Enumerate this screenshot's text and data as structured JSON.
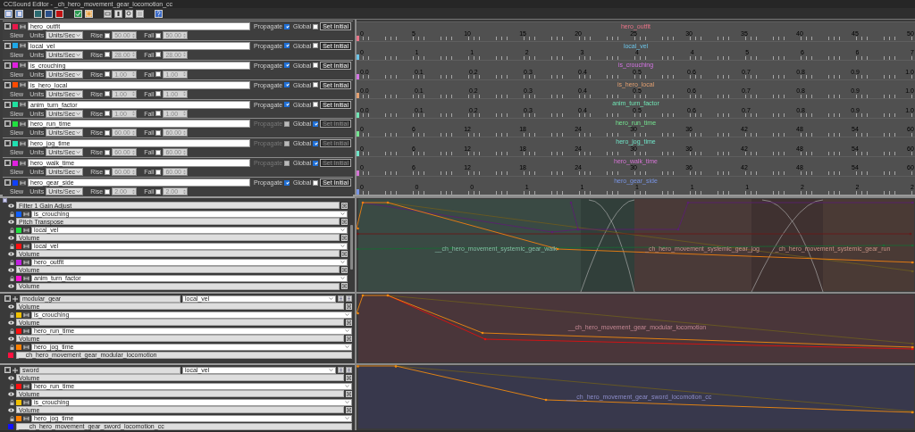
{
  "window": {
    "title": "CCSound Editor - _ch_hero_movement_gear_locomotion_cc"
  },
  "parameters": [
    {
      "name": "hero_outfit",
      "color": "#e8174a",
      "propagate_label": "Propagate",
      "propagate": true,
      "propagate_disabled": false,
      "global_label": "Global",
      "global": false,
      "set_initial": "Set Initial",
      "set_initial_disabled": false,
      "slew_label": "Slew",
      "units_label": "Units",
      "units": "Units/Sec",
      "rise_label": "Rise",
      "rise_checked": false,
      "rise": "50.00",
      "fall_label": "Fall",
      "fall_checked": false,
      "fall": "50.00"
    },
    {
      "name": "local_vel",
      "color": "#1ea8e8",
      "propagate_label": "Propagate",
      "propagate": true,
      "propagate_disabled": false,
      "global_label": "Global",
      "global": false,
      "set_initial": "Set Initial",
      "set_initial_disabled": false,
      "slew_label": "Slew",
      "units_label": "Units",
      "units": "Units/Sec",
      "rise_label": "Rise",
      "rise_checked": false,
      "rise": "28.00",
      "fall_label": "Fall",
      "fall_checked": false,
      "fall": "28.00"
    },
    {
      "name": "is_crouching",
      "color": "#e020e0",
      "propagate_label": "Propagate",
      "propagate": true,
      "propagate_disabled": false,
      "global_label": "Global",
      "global": false,
      "set_initial": "Set Initial",
      "set_initial_disabled": false,
      "slew_label": "Slew",
      "units_label": "Units",
      "units": "Units/Sec",
      "rise_label": "Rise",
      "rise_checked": false,
      "rise": "1.00",
      "fall_label": "Fall",
      "fall_checked": false,
      "fall": "1.00"
    },
    {
      "name": "is_hero_local",
      "color": "#ff4a00",
      "propagate_label": "Propagate",
      "propagate": true,
      "propagate_disabled": false,
      "global_label": "Global",
      "global": false,
      "set_initial": "Set Initial",
      "set_initial_disabled": false,
      "slew_label": "Slew",
      "units_label": "Units",
      "units": "Units/Sec",
      "rise_label": "Rise",
      "rise_checked": false,
      "rise": "1.00",
      "fall_label": "Fall",
      "fall_checked": false,
      "fall": "1.00"
    },
    {
      "name": "anim_turn_factor",
      "color": "#20e0a0",
      "propagate_label": "Propagate",
      "propagate": true,
      "propagate_disabled": false,
      "global_label": "Global",
      "global": false,
      "set_initial": "Set Initial",
      "set_initial_disabled": false,
      "slew_label": "Slew",
      "units_label": "Units",
      "units": "Units/Sec",
      "rise_label": "Rise",
      "rise_checked": false,
      "rise": "1.00",
      "fall_label": "Fall",
      "fall_checked": false,
      "fall": "1.00"
    },
    {
      "name": "hero_run_time",
      "color": "#20e040",
      "propagate_label": "Propagate",
      "propagate": false,
      "propagate_disabled": true,
      "global_label": "Global",
      "global": true,
      "set_initial": "Set Initial",
      "set_initial_disabled": true,
      "slew_label": "Slew",
      "units_label": "Units",
      "units": "Units/Sec",
      "rise_label": "Rise",
      "rise_checked": false,
      "rise": "60.00",
      "fall_label": "Fall",
      "fall_checked": false,
      "fall": "60.00"
    },
    {
      "name": "hero_jog_time",
      "color": "#20e0b0",
      "propagate_label": "Propagate",
      "propagate": false,
      "propagate_disabled": true,
      "global_label": "Global",
      "global": true,
      "set_initial": "Set Initial",
      "set_initial_disabled": true,
      "slew_label": "Slew",
      "units_label": "Units",
      "units": "Units/Sec",
      "rise_label": "Rise",
      "rise_checked": false,
      "rise": "60.00",
      "fall_label": "Fall",
      "fall_checked": false,
      "fall": "60.00"
    },
    {
      "name": "hero_walk_time",
      "color": "#e020e0",
      "propagate_label": "Propagate",
      "propagate": false,
      "propagate_disabled": true,
      "global_label": "Global",
      "global": true,
      "set_initial": "Set Initial",
      "set_initial_disabled": true,
      "slew_label": "Slew",
      "units_label": "Units",
      "units": "Units/Sec",
      "rise_label": "Rise",
      "rise_checked": false,
      "rise": "60.00",
      "fall_label": "Fall",
      "fall_checked": false,
      "fall": "60.00"
    },
    {
      "name": "hero_gear_side",
      "color": "#1040ff",
      "propagate_label": "Propagate",
      "propagate": true,
      "propagate_disabled": false,
      "global_label": "Global",
      "global": false,
      "set_initial": "Set Initial",
      "set_initial_disabled": false,
      "slew_label": "Slew",
      "units_label": "Units",
      "units": "Units/Sec",
      "rise_label": "Rise",
      "rise_checked": false,
      "rise": "2.00",
      "fall_label": "Fall",
      "fall_checked": false,
      "fall": "2.00"
    }
  ],
  "rulers": [
    {
      "label": "hero_outfit",
      "color": "#e87488",
      "ticks": [
        "0",
        "5",
        "10",
        "15",
        "20",
        "25",
        "30",
        "35",
        "40",
        "45",
        "50"
      ]
    },
    {
      "label": "local_vel",
      "color": "#6cc4e8",
      "ticks": [
        "0",
        "1",
        "1",
        "2",
        "3",
        "4",
        "4",
        "5",
        "6",
        "6",
        "7"
      ]
    },
    {
      "label": "is_crouching",
      "color": "#d474e4",
      "ticks": [
        "0.0",
        "0.1",
        "0.2",
        "0.3",
        "0.4",
        "0.5",
        "0.6",
        "0.7",
        "0.8",
        "0.9",
        "1.0"
      ]
    },
    {
      "label": "is_hero_local",
      "color": "#e4a070",
      "ticks": [
        "0.0",
        "0.1",
        "0.2",
        "0.3",
        "0.4",
        "0.5",
        "0.6",
        "0.7",
        "0.8",
        "0.9",
        "1.0"
      ]
    },
    {
      "label": "anim_turn_factor",
      "color": "#70e4b4",
      "ticks": [
        "0.0",
        "0.1",
        "0.2",
        "0.3",
        "0.4",
        "0.5",
        "0.6",
        "0.7",
        "0.8",
        "0.9",
        "1.0"
      ]
    },
    {
      "label": "hero_run_time",
      "color": "#74e490",
      "ticks": [
        "0",
        "6",
        "12",
        "18",
        "24",
        "30",
        "36",
        "42",
        "48",
        "54",
        "60"
      ]
    },
    {
      "label": "hero_jog_time",
      "color": "#70e4c8",
      "ticks": [
        "0",
        "6",
        "12",
        "18",
        "24",
        "30",
        "36",
        "42",
        "48",
        "54",
        "60"
      ]
    },
    {
      "label": "hero_walk_time",
      "color": "#d474d4",
      "ticks": [
        "0",
        "6",
        "12",
        "18",
        "24",
        "30",
        "36",
        "42",
        "48",
        "54",
        "60"
      ]
    },
    {
      "label": "hero_gear_side",
      "color": "#7894e4",
      "ticks": [
        "0",
        "0",
        "0",
        "1",
        "1",
        "1",
        "1",
        "1",
        "2",
        "2",
        "2"
      ]
    }
  ],
  "layer_groups": [
    {
      "scrollable": true,
      "effects": [
        {
          "effect": "Filter 1 Gain Adjust",
          "color": "#1060ff",
          "parameter": "is_crouching"
        },
        {
          "effect": "Pitch Transpose",
          "color": "#20e040",
          "parameter": "local_vel"
        },
        {
          "effect": "Volume",
          "color": "#ff1010",
          "parameter": "local_vel"
        },
        {
          "effect": "Volume",
          "color": "#c020e0",
          "parameter": "hero_outfit"
        },
        {
          "effect": "Volume",
          "color": "#ff10d0",
          "parameter": "anim_turn_factor"
        },
        {
          "effect": "Volume"
        }
      ]
    },
    {
      "scrollable": false,
      "name": "modular_gear",
      "parameter": "local_vel",
      "effects": [
        {
          "effect": "Volume",
          "color": "#f0c000",
          "parameter": "is_crouching"
        },
        {
          "effect": "Volume",
          "color": "#ff1010",
          "parameter": "hero_run_time"
        },
        {
          "effect": "Volume",
          "color": "#ff8000",
          "parameter": "hero_jog_time"
        }
      ],
      "footer": {
        "color": "#ff1040",
        "name": "__ch_hero_movement_gear_modular_locomotion"
      }
    },
    {
      "scrollable": false,
      "name": "sword",
      "parameter": "local_vel",
      "effects": [
        {
          "effect": "Volume",
          "color": "#ff1010",
          "parameter": "hero_run_time"
        },
        {
          "effect": "Volume",
          "color": "#f0c000",
          "parameter": "is_crouching"
        },
        {
          "effect": "Volume",
          "color": "#ff8000",
          "parameter": "hero_jog_time"
        }
      ],
      "footer": {
        "color": "#1010ff",
        "name": "___ch_hero_movement_gear_sword_locomotion_cc"
      }
    }
  ],
  "tracks": [
    {
      "regions": [
        {
          "label": "__ch_hero_movement_systemic_gear_walk",
          "color": "#3a4a44"
        },
        {
          "label": "_ch_hero_movement_systemic_gear_jog",
          "color": "#4a3a38"
        },
        {
          "label": "_ch_hero_movement_systemic_gear_run",
          "color": "#4a3a35"
        }
      ]
    },
    {
      "regions": [
        {
          "label": "__ch_hero_movement_gear_modular_locomotion",
          "color": "#4a363a"
        }
      ]
    },
    {
      "regions": [
        {
          "label": "___ch_hero_movement_gear_sword_locomotion_cc",
          "color": "#38384c"
        }
      ]
    }
  ]
}
